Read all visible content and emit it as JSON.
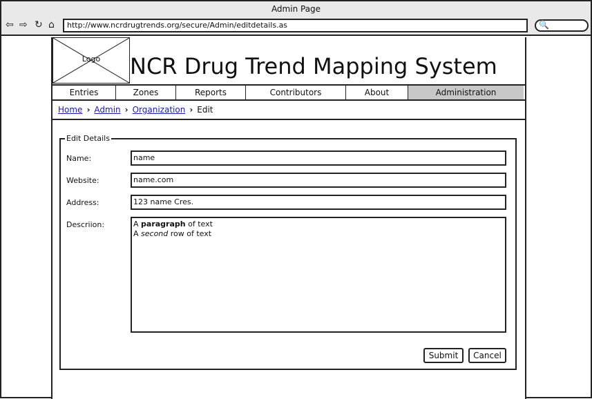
{
  "window": {
    "title": "Admin Page"
  },
  "toolbar": {
    "url": "http://www.ncrdrugtrends.org/secure/Admin/editdetails.as",
    "back_icon": "back-arrow-icon",
    "forward_icon": "forward-arrow-icon",
    "reload_icon": "reload-icon",
    "home_icon": "home-icon",
    "search_icon": "search-icon"
  },
  "header": {
    "logo_label": "Logo",
    "site_title": "NCR Drug Trend Mapping System"
  },
  "nav": {
    "tabs": [
      {
        "label": "Entries"
      },
      {
        "label": "Zones"
      },
      {
        "label": "Reports"
      },
      {
        "label": "Contributors"
      },
      {
        "label": "About"
      },
      {
        "label": "Administration",
        "active": true
      }
    ]
  },
  "breadcrumb": {
    "items": [
      "Home",
      "Admin",
      "Organization"
    ],
    "current": "Edit"
  },
  "form": {
    "legend": "Edit Details",
    "name_label": "Name:",
    "name_value": "name",
    "website_label": "Website:",
    "website_value": "name.com",
    "address_label": "Address:",
    "address_value": "123 name Cres.",
    "description_label": "Descriion:",
    "description_line1": {
      "a": "A ",
      "b": "paragraph",
      "c": " of text"
    },
    "description_line2": {
      "a": "A ",
      "b": "second",
      "c": " row of text"
    },
    "submit_label": "Submit",
    "cancel_label": "Cancel"
  },
  "colors": {
    "active_tab": "#c8c8c8",
    "link": "#1a1aa6"
  }
}
